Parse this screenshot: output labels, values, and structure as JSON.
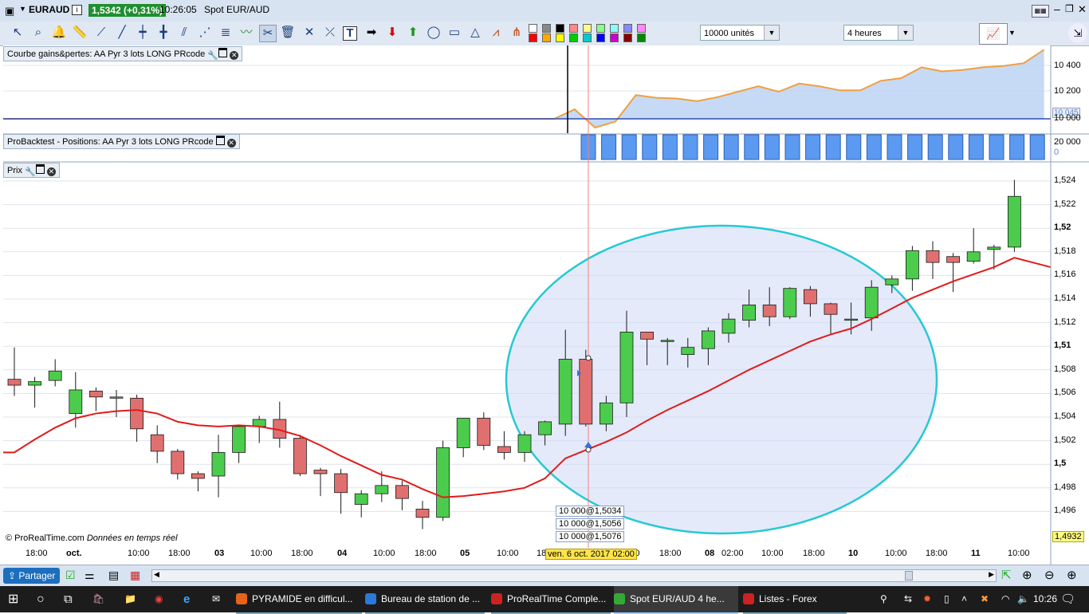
{
  "titlebar": {
    "symbol": "EURAUD",
    "price_badge": "1,5342 (+0,31%)",
    "time": "10:26:05",
    "instrument": "Spot EUR/AUD"
  },
  "toolbar": {
    "quantity_select": "10000 unités",
    "timeframe_select": "4 heures",
    "swatch_colors": [
      "#ffffff",
      "#888888",
      "#000000",
      "#ff8888",
      "#ffff88",
      "#88ff88",
      "#88ffff",
      "#8888ff",
      "#ff88ff",
      "#ff0000",
      "#ffaa00",
      "#ffff00",
      "#00cc00",
      "#00cccc",
      "#0000ff",
      "#cc00cc",
      "#880000",
      "#008800"
    ]
  },
  "panel_equity": {
    "label": "Courbe gains&pertes: AA Pyr 3 lots  LONG PRcode",
    "y_labels": [
      "10 400",
      "10 200",
      "10 045",
      "10 000"
    ]
  },
  "panel_positions": {
    "label": "ProBacktest - Positions: AA Pyr 3 lots  LONG PRcode",
    "y_labels": [
      "20 000",
      "0"
    ],
    "bar_count": 23
  },
  "panel_price": {
    "label": "Prix",
    "current_price": "1,4932",
    "copyright": "© ProRealTime.com",
    "realtime_note": "Données en temps réel",
    "order_tags": [
      "10 000@1,5034",
      "10 000@1,5056",
      "10 000@1,5076"
    ],
    "cursor_date": "ven. 6 oct. 2017 02:00"
  },
  "chart_data": {
    "type": "candlestick",
    "ylim": [
      1.494,
      1.525
    ],
    "y_ticks": [
      "1,524",
      "1,522",
      "1,52",
      "1,518",
      "1,516",
      "1,514",
      "1,512",
      "1,51",
      "1,508",
      "1,506",
      "1,504",
      "1,502",
      "1,5",
      "1,498",
      "1,496"
    ],
    "x_ticks": [
      "18:00",
      "oct.",
      "10:00",
      "18:00",
      "03",
      "10:00",
      "18:00",
      "04",
      "10:00",
      "18:00",
      "05",
      "10:00",
      "18:00",
      "10:00",
      "18:00",
      "08",
      "02:00",
      "10:00",
      "18:00",
      "10",
      "10:00",
      "18:00",
      "11",
      "10:00"
    ],
    "candles": [
      [
        1.5072,
        1.5099,
        1.5058,
        1.5067
      ],
      [
        1.5067,
        1.5074,
        1.5048,
        1.507
      ],
      [
        1.5071,
        1.5089,
        1.5066,
        1.5079
      ],
      [
        1.5043,
        1.5078,
        1.5031,
        1.5063
      ],
      [
        1.5062,
        1.5065,
        1.5045,
        1.5057
      ],
      [
        1.5057,
        1.5063,
        1.504,
        1.5056
      ],
      [
        1.5056,
        1.5059,
        1.5019,
        1.503
      ],
      [
        1.5025,
        1.5033,
        1.5001,
        1.5011
      ],
      [
        1.5011,
        1.5013,
        1.4987,
        1.4992
      ],
      [
        1.4992,
        1.4994,
        1.4977,
        1.4988
      ],
      [
        1.499,
        1.5025,
        1.4972,
        1.501
      ],
      [
        1.501,
        1.5031,
        1.5001,
        1.5032
      ],
      [
        1.5032,
        1.5041,
        1.5018,
        1.5038
      ],
      [
        1.5038,
        1.5053,
        1.5014,
        1.5022
      ],
      [
        1.5022,
        1.5025,
        1.499,
        1.4992
      ],
      [
        1.4995,
        1.4997,
        1.4973,
        1.4992
      ],
      [
        1.4992,
        1.4996,
        1.4958,
        1.4976
      ],
      [
        1.4966,
        1.4978,
        1.4955,
        1.4975
      ],
      [
        1.4975,
        1.4994,
        1.4968,
        1.4982
      ],
      [
        1.4982,
        1.4986,
        1.4961,
        1.4971
      ],
      [
        1.4962,
        1.4969,
        1.4945,
        1.4955
      ],
      [
        1.4955,
        1.502,
        1.4952,
        1.5014
      ],
      [
        1.5014,
        1.5039,
        1.5006,
        1.5039
      ],
      [
        1.5039,
        1.5044,
        1.5012,
        1.5016
      ],
      [
        1.5015,
        1.5028,
        1.5004,
        1.501
      ],
      [
        1.501,
        1.5028,
        1.5002,
        1.5025
      ],
      [
        1.5025,
        1.5037,
        1.5016,
        1.5036
      ],
      [
        1.5034,
        1.5114,
        1.5024,
        1.5089
      ],
      [
        1.5089,
        1.5097,
        1.5032,
        1.5034
      ],
      [
        1.5034,
        1.5058,
        1.5028,
        1.5052
      ],
      [
        1.5052,
        1.513,
        1.504,
        1.5112
      ],
      [
        1.5112,
        1.5112,
        1.5084,
        1.5106
      ],
      [
        1.5104,
        1.5107,
        1.5084,
        1.5105
      ],
      [
        1.5093,
        1.5107,
        1.5082,
        1.5099
      ],
      [
        1.5098,
        1.5116,
        1.5084,
        1.5113
      ],
      [
        1.5111,
        1.5128,
        1.5103,
        1.5123
      ],
      [
        1.5122,
        1.5148,
        1.5116,
        1.5135
      ],
      [
        1.5135,
        1.515,
        1.5117,
        1.5125
      ],
      [
        1.5125,
        1.515,
        1.5123,
        1.5149
      ],
      [
        1.5148,
        1.5151,
        1.5125,
        1.5136
      ],
      [
        1.5136,
        1.5137,
        1.511,
        1.5127
      ],
      [
        1.5122,
        1.5137,
        1.511,
        1.5123
      ],
      [
        1.5124,
        1.5156,
        1.5113,
        1.515
      ],
      [
        1.5152,
        1.516,
        1.5145,
        1.5157
      ],
      [
        1.5157,
        1.5185,
        1.5147,
        1.5181
      ],
      [
        1.5181,
        1.5189,
        1.5157,
        1.5171
      ],
      [
        1.5176,
        1.5179,
        1.5146,
        1.5171
      ],
      [
        1.5172,
        1.52,
        1.517,
        1.518
      ],
      [
        1.5182,
        1.5186,
        1.5165,
        1.5184
      ],
      [
        1.5184,
        1.5241,
        1.518,
        1.5227
      ]
    ],
    "ma": [
      1.501,
      1.5021,
      1.5031,
      1.5039,
      1.5043,
      1.5045,
      1.5046,
      1.5043,
      1.5036,
      1.5033,
      1.5032,
      1.5033,
      1.5032,
      1.5029,
      1.5024,
      1.5016,
      1.5007,
      1.4999,
      1.4991,
      1.4987,
      1.4979,
      1.4972,
      1.4973,
      1.4975,
      1.4977,
      1.498,
      1.4988,
      1.5005,
      1.5012,
      1.5019,
      1.5027,
      1.5037,
      1.5046,
      1.5054,
      1.5062,
      1.5071,
      1.508,
      1.5088,
      1.5096,
      1.5104,
      1.511,
      1.5115,
      1.5123,
      1.5132,
      1.5141,
      1.5148,
      1.5155,
      1.5161,
      1.5167,
      1.5175
    ]
  },
  "equity_values": [
    10000,
    10000,
    10000,
    10000,
    10000,
    10000,
    10000,
    10000,
    10000,
    10000,
    10000,
    10000,
    10000,
    10000,
    10000,
    10000,
    10000,
    10000,
    10000,
    10000,
    10000,
    10000,
    10000,
    10000,
    10000,
    10000,
    10000,
    10000,
    10070,
    9935,
    9980,
    10175,
    10155,
    10150,
    10130,
    10160,
    10200,
    10240,
    10200,
    10260,
    10240,
    10210,
    10210,
    10280,
    10300,
    10380,
    10350,
    10360,
    10380,
    10390,
    10410,
    10510
  ],
  "bottombar": {
    "share_label": "Partager"
  },
  "taskbar": {
    "items": [
      "PYRAMIDE en difficul...",
      "Bureau de station de ...",
      "ProRealTime Comple...",
      "Spot EUR/AUD   4 he...",
      "Listes - Forex"
    ],
    "clock": "10:26"
  }
}
